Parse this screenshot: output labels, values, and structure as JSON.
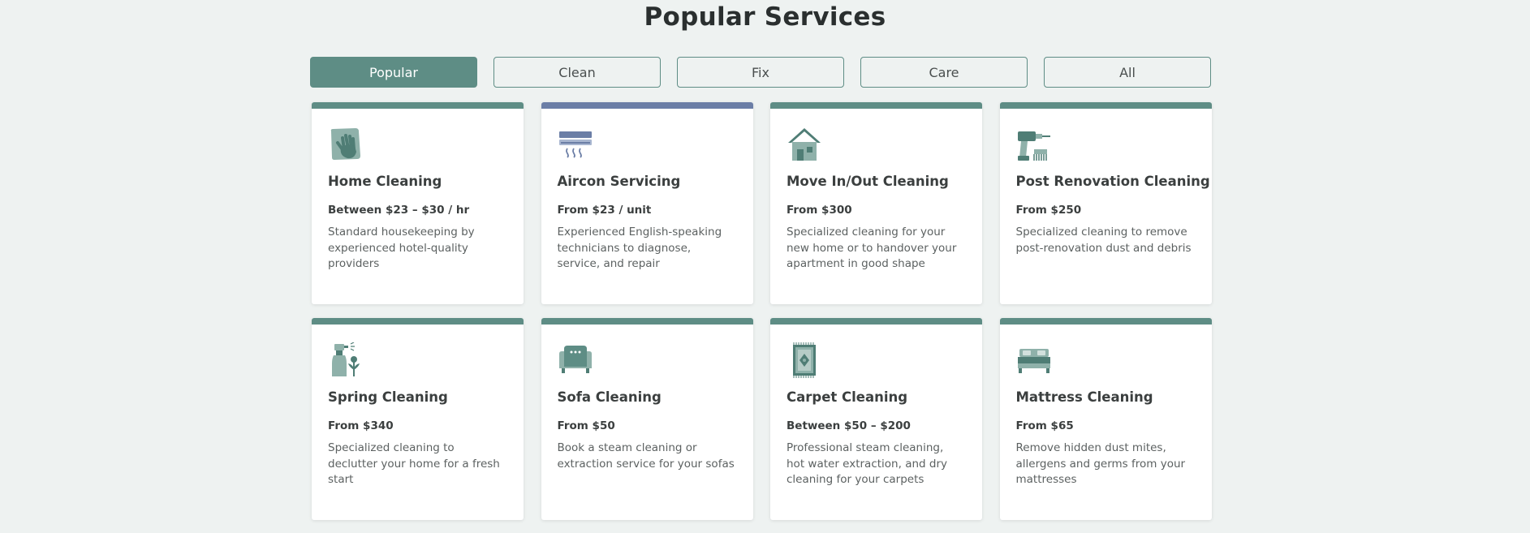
{
  "title": "Popular Services",
  "colors": {
    "accent": "#5e8d85",
    "aircon_accent": "#6b7ea6",
    "background": "#eef2f1"
  },
  "tabs": [
    {
      "label": "Popular",
      "active": true
    },
    {
      "label": "Clean",
      "active": false
    },
    {
      "label": "Fix",
      "active": false
    },
    {
      "label": "Care",
      "active": false
    },
    {
      "label": "All",
      "active": false
    }
  ],
  "services": [
    {
      "icon": "cleaning-cloth-icon",
      "title": "Home Cleaning",
      "price": "Between $23 – $30 / hr",
      "description": "Standard housekeeping by experienced hotel-quality providers"
    },
    {
      "icon": "aircon-icon",
      "title": "Aircon Servicing",
      "price": "From $23 / unit",
      "description": "Experienced English-speaking technicians to diagnose, service, and repair"
    },
    {
      "icon": "house-icon",
      "title": "Move In/Out Cleaning",
      "price": "From $300",
      "description": "Specialized cleaning for your new home or to handover your apartment in good shape"
    },
    {
      "icon": "drill-icon",
      "title": "Post Renovation Cleaning",
      "price": "From $250",
      "description": "Specialized cleaning to remove post-renovation dust and debris"
    },
    {
      "icon": "spray-bottle-icon",
      "title": "Spring Cleaning",
      "price": "From $340",
      "description": "Specialized cleaning to declutter your home for a fresh start"
    },
    {
      "icon": "sofa-icon",
      "title": "Sofa Cleaning",
      "price": "From $50",
      "description": "Book a steam cleaning or extraction service for your sofas"
    },
    {
      "icon": "carpet-icon",
      "title": "Carpet Cleaning",
      "price": "Between $50 – $200",
      "description": "Professional steam cleaning, hot water extraction, and dry cleaning for your carpets"
    },
    {
      "icon": "mattress-icon",
      "title": "Mattress Cleaning",
      "price": "From $65",
      "description": "Remove hidden dust mites, allergens and germs from your mattresses"
    }
  ]
}
